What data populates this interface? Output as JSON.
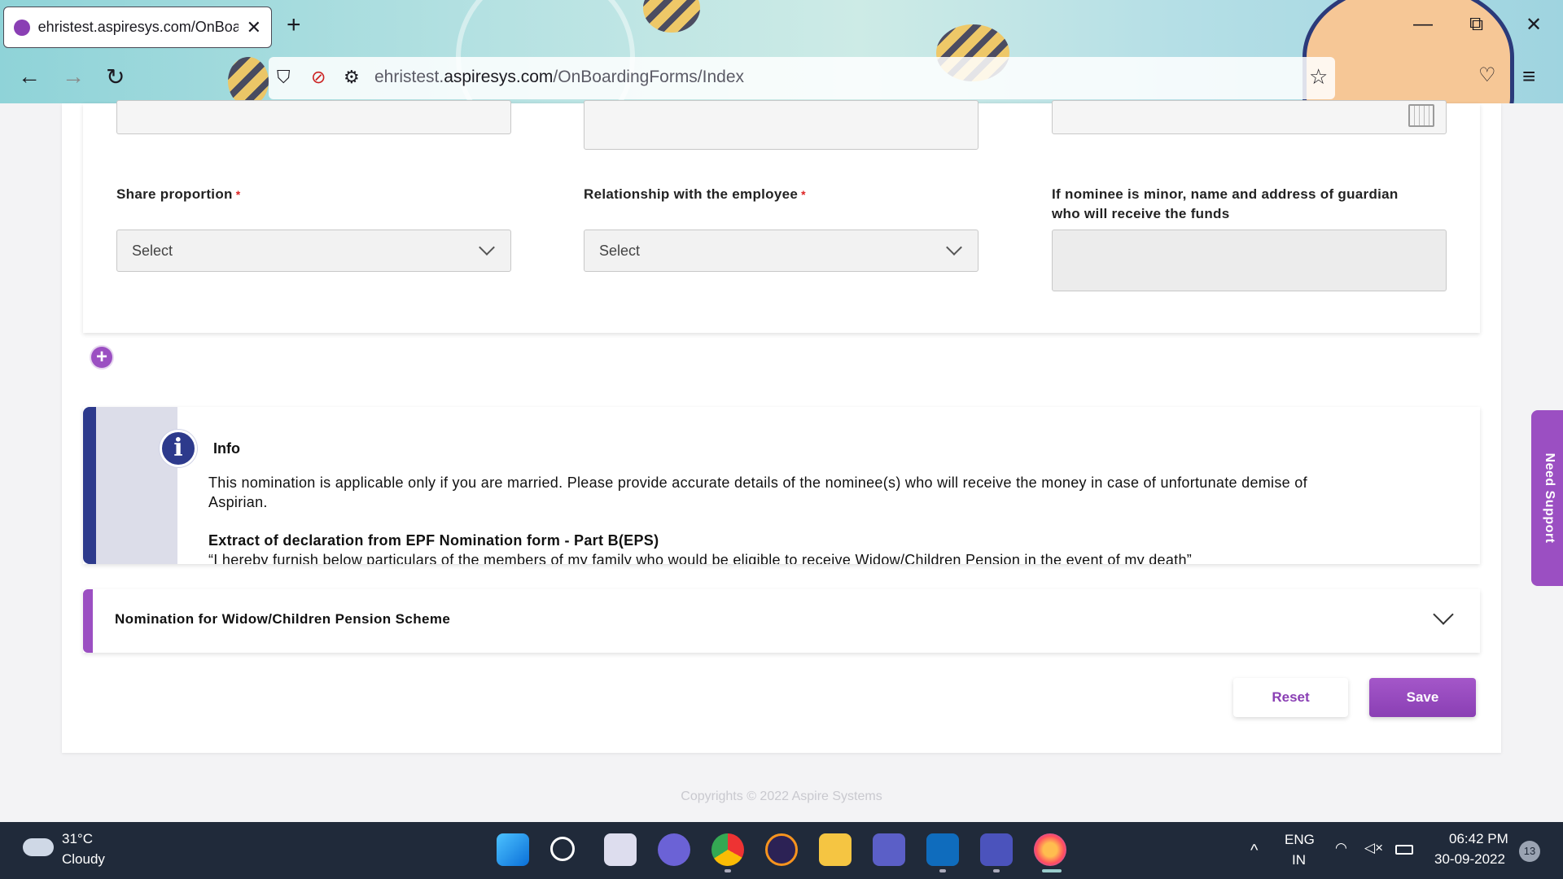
{
  "browser": {
    "tab_title": "ehristest.aspiresys.com/OnBoar",
    "tab_close": "✕",
    "new_tab": "+",
    "url_prefix": "ehristest.",
    "url_domain": "aspiresys.com",
    "url_path": "/OnBoardingForms/Index",
    "minimize": "—",
    "restore": "⧉",
    "close": "✕",
    "back": "←",
    "forward": "→",
    "reload": "↻",
    "bookmark": "☆",
    "shield": "⛉",
    "pocket": "♡",
    "menu": "≡"
  },
  "form": {
    "share_label": "Share proportion",
    "share_required": "*",
    "share_value": "Select",
    "relationship_label": "Relationship with the employee",
    "relationship_required": "*",
    "relationship_value": "Select",
    "guardian_label_line1": "If nominee is minor, name and address of guardian",
    "guardian_label_line2": "who will receive the funds",
    "add_icon": "+"
  },
  "info": {
    "icon": "i",
    "title": "Info",
    "text_line1": "This nomination is applicable only if you are married. Please provide accurate details of the nominee(s) who will receive the money in case of unfortunate demise of",
    "text_line2": "Aspirian.",
    "extract_title": "Extract of declaration from EPF Nomination form - Part B(EPS)",
    "extract_quote": "“I hereby furnish below particulars of the members of my family who would be eligible to receive Widow/Children Pension in the event of my death”"
  },
  "accordion": {
    "title": "Nomination for Widow/Children Pension Scheme"
  },
  "actions": {
    "reset": "Reset",
    "save": "Save"
  },
  "footer": "Copyrights © 2022 Aspire Systems",
  "support": "Need Support",
  "taskbar": {
    "temp": "31°C",
    "weather": "Cloudy",
    "lang1": "ENG",
    "lang2": "IN",
    "time": "06:42 PM",
    "date": "30-09-2022",
    "notifications": "13",
    "chevron": "^"
  }
}
